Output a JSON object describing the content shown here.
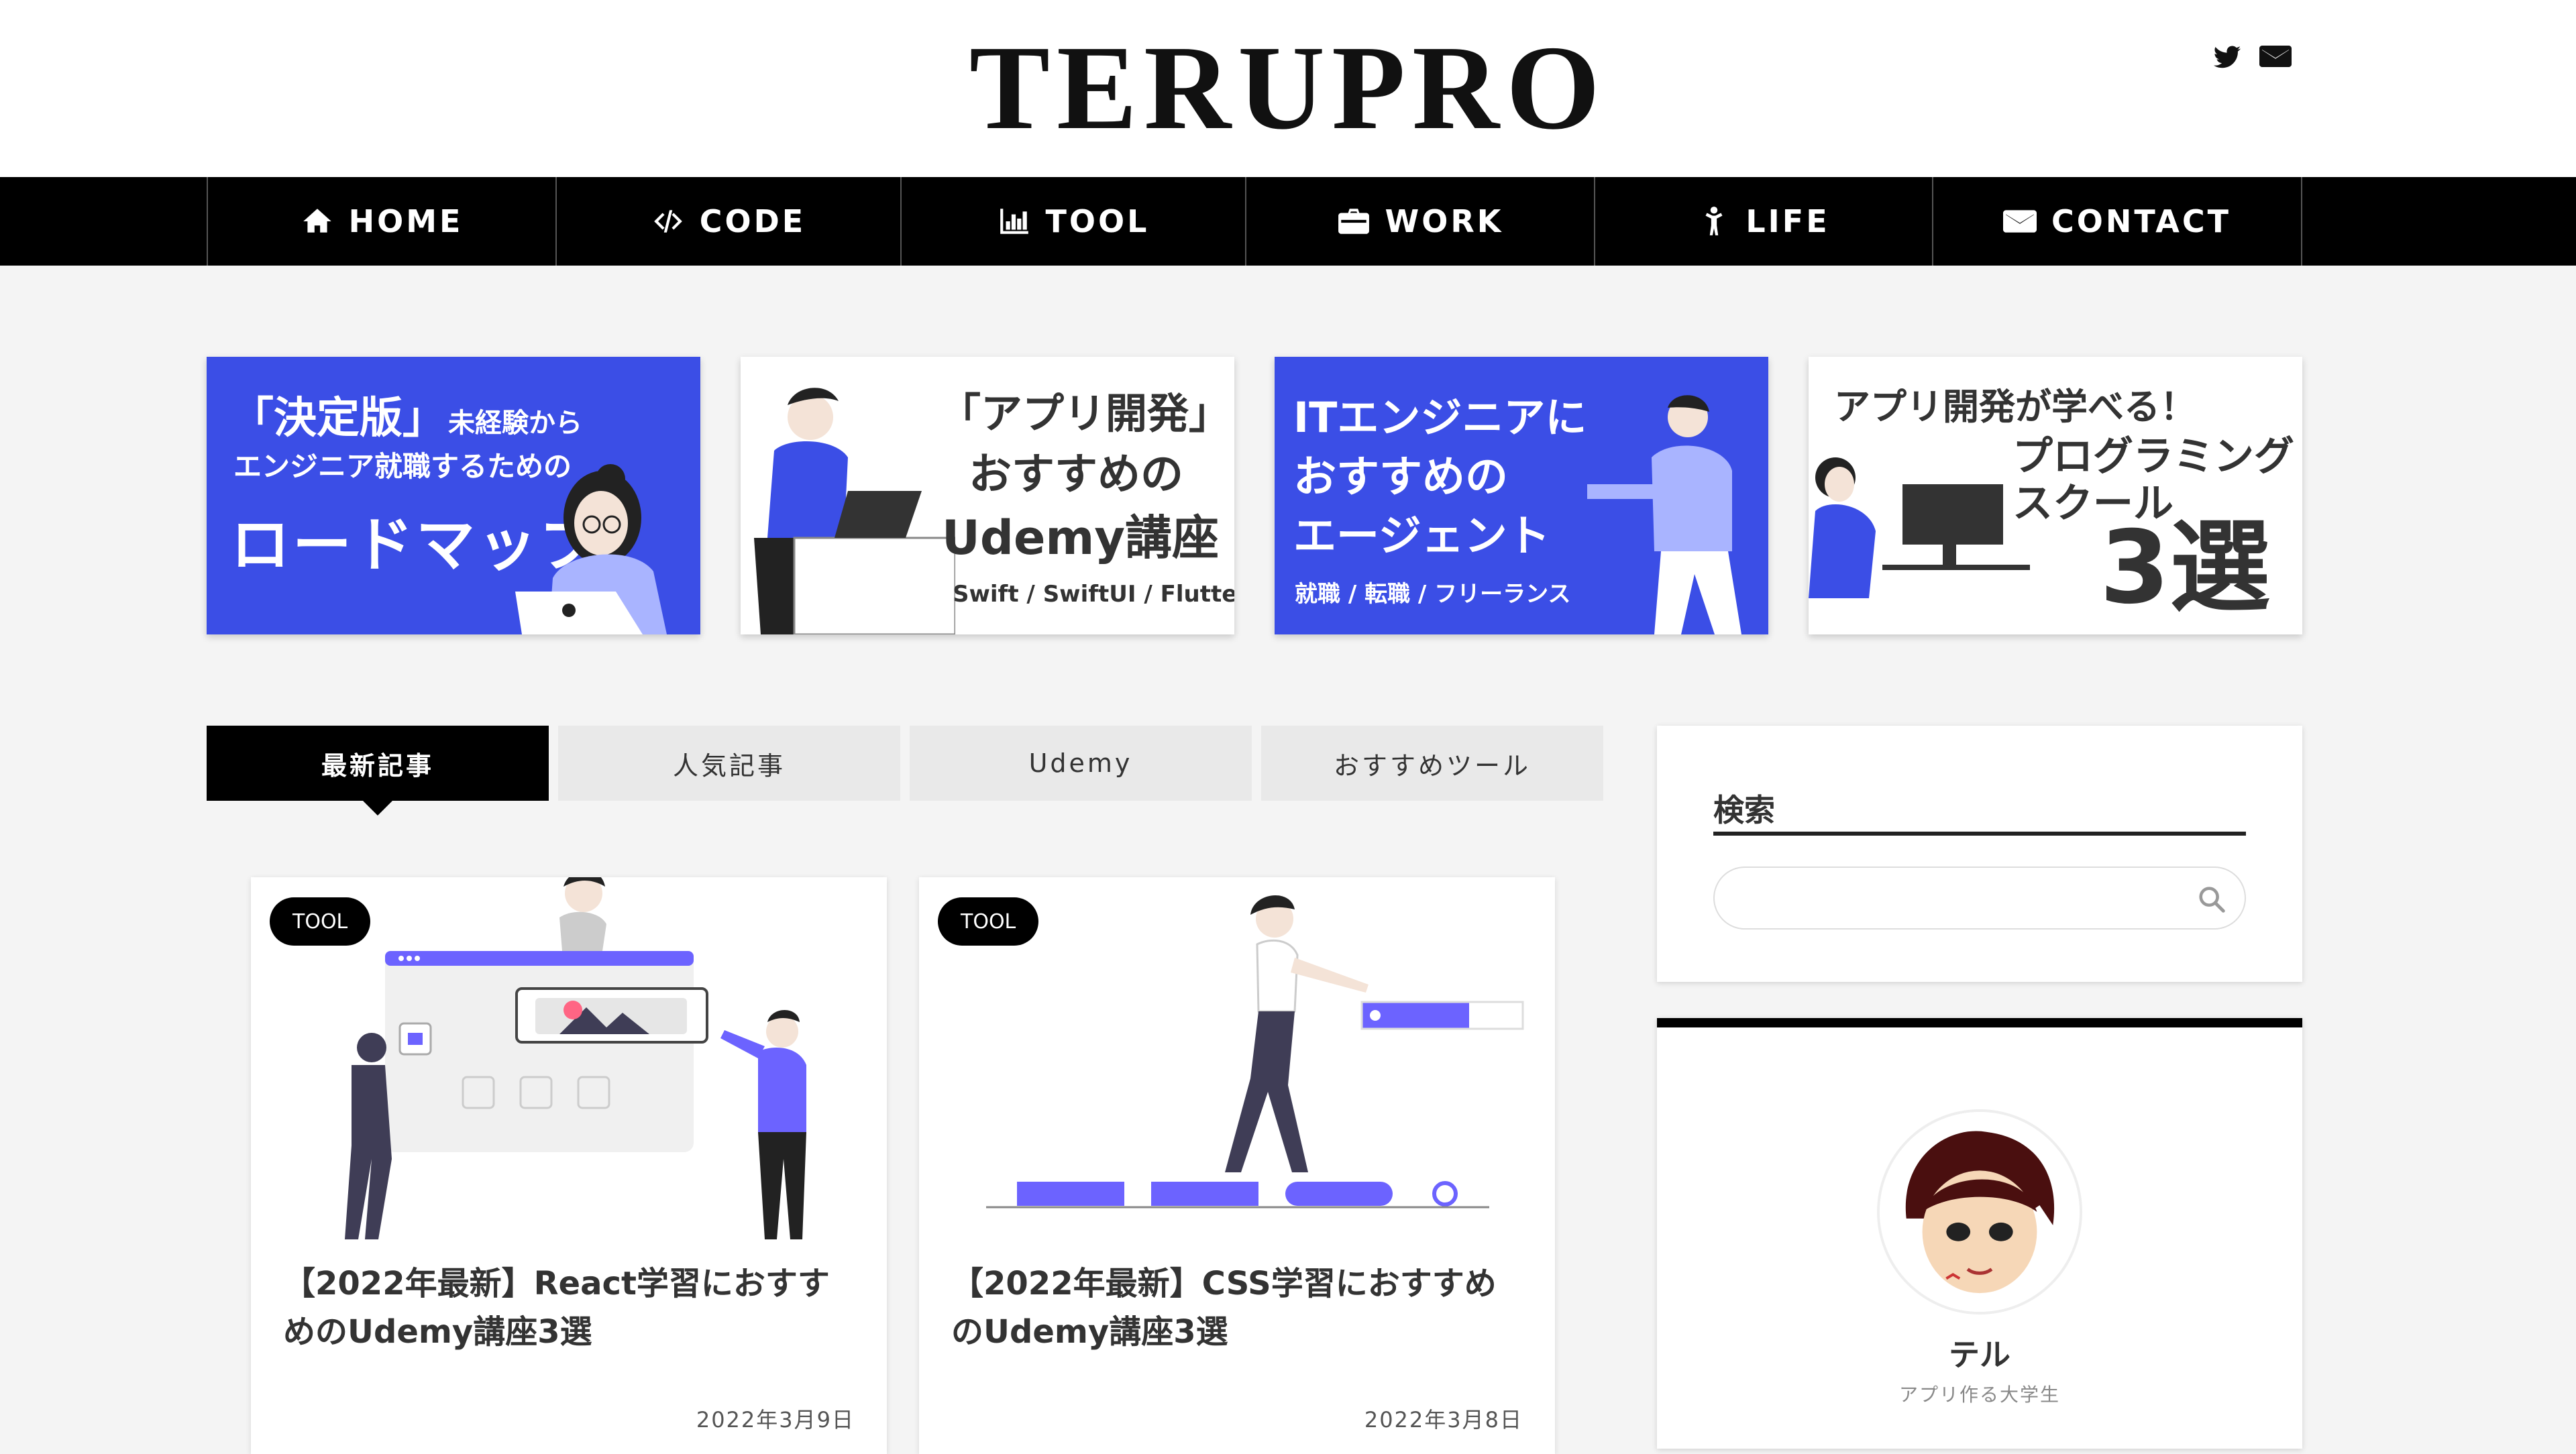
{
  "site": {
    "logo": "TERUPRO"
  },
  "header_icons": [
    "twitter-icon",
    "mail-icon"
  ],
  "nav": [
    {
      "label": "HOME",
      "icon": "home-icon"
    },
    {
      "label": "CODE",
      "icon": "code-icon"
    },
    {
      "label": "TOOL",
      "icon": "bar-chart-icon"
    },
    {
      "label": "WORK",
      "icon": "briefcase-icon"
    },
    {
      "label": "LIFE",
      "icon": "child-icon"
    },
    {
      "label": "CONTACT",
      "icon": "mail-icon"
    }
  ],
  "banners": [
    {
      "line1": "「決定版」",
      "line1b": "未経験から",
      "line2": "エンジニア就職するための",
      "line3": "ロードマップ"
    },
    {
      "line1": "「アプリ開発」",
      "line2": "おすすめの",
      "line3": "Udemy講座",
      "sub": "Swift / SwiftUI / Flutter"
    },
    {
      "line1": "ITエンジニアに",
      "line2": "おすすめの",
      "line3": "エージェント",
      "sub": "就職 / 転職 / フリーランス"
    },
    {
      "line1": "アプリ開発が学べる！",
      "line2": "プログラミング",
      "line3": "スクール",
      "line4": "3選"
    }
  ],
  "tabs": [
    "最新記事",
    "人気記事",
    "Udemy",
    "おすすめツール"
  ],
  "active_tab": "最新記事",
  "posts": [
    {
      "category": "TOOL",
      "title": "【2022年最新】React学習におすすめのUdemy講座3選",
      "date": "2022年3月9日"
    },
    {
      "category": "TOOL",
      "title": "【2022年最新】CSS学習におすすめのUdemy講座3選",
      "date": "2022年3月8日"
    }
  ],
  "sidebar": {
    "search": {
      "title": "検索",
      "placeholder": ""
    },
    "profile": {
      "name": "テル",
      "subtitle": "アプリ作る大学生"
    }
  },
  "colors": {
    "accent": "#3b4ee6",
    "nav_bg": "#000000",
    "page_bg": "#f4f4f4",
    "illustration": "#6c63ff"
  }
}
